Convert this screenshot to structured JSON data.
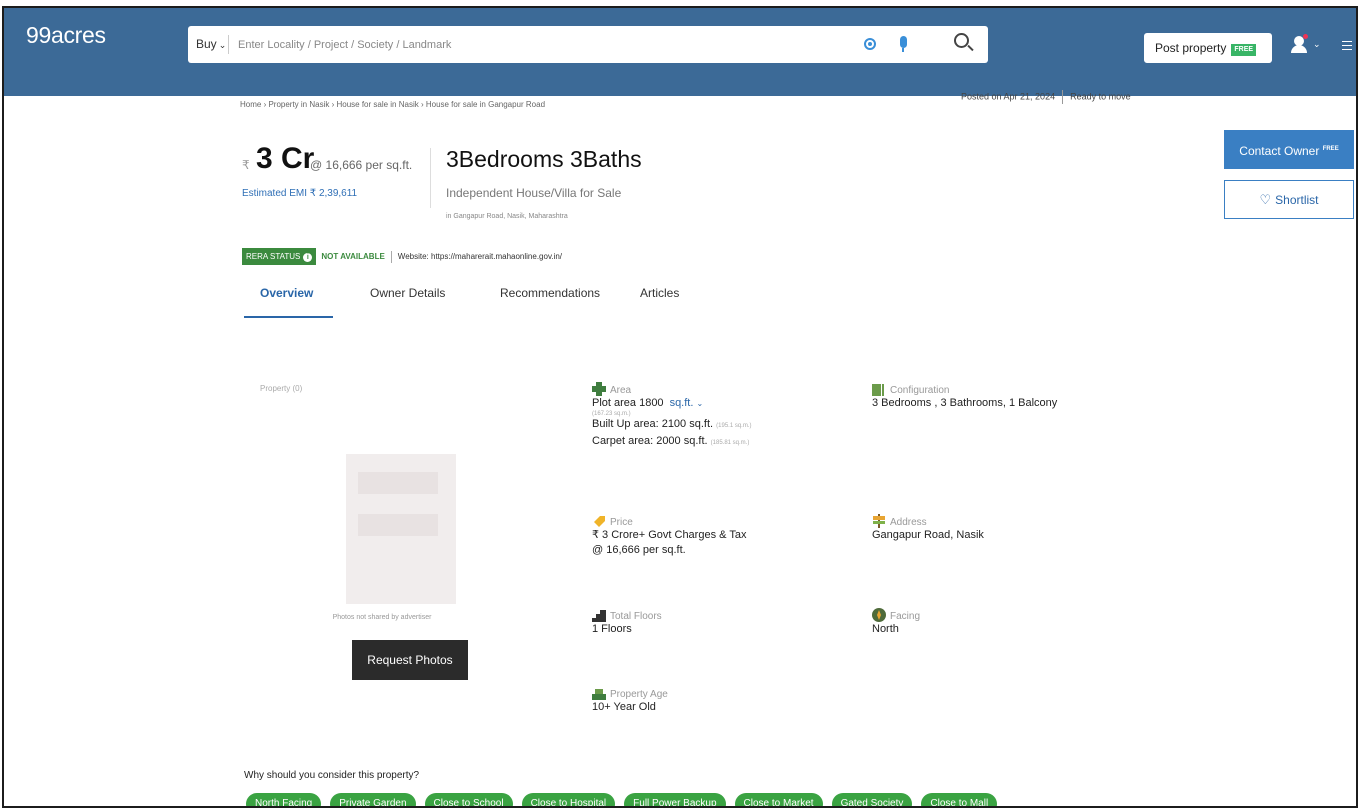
{
  "header": {
    "logo": "99acres",
    "search": {
      "category": "Buy",
      "placeholder": "Enter Locality / Project / Society / Landmark"
    },
    "post_property_label": "Post property",
    "post_property_tag": "FREE"
  },
  "breadcrumb": "Home › Property in Nasik › House for sale in Nasik › House for sale in Gangapur Road",
  "posted": {
    "date": "Posted on Apr 21, 2024",
    "status": "Ready to move"
  },
  "summary": {
    "price": "3 Cr",
    "per_sqft": "@ 16,666 per sq.ft.",
    "emi": "Estimated EMI ₹ 2,39,611",
    "bhk_title": "3Bedrooms 3Baths",
    "property_type": "Independent House/Villa for Sale",
    "locality": "in Gangapur Road, Nasik, Maharashtra"
  },
  "rera": {
    "badge": "RERA STATUS",
    "status": "NOT AVAILABLE",
    "website": "Website: https://maharerait.mahaonline.gov.in/"
  },
  "tabs": [
    "Overview",
    "Owner Details",
    "Recommendations",
    "Articles"
  ],
  "actions": {
    "contact_owner": "Contact Owner",
    "contact_tag": "FREE",
    "shortlist": "Shortlist"
  },
  "photos": {
    "label": "Property (0)",
    "note": "Photos not shared by advertiser",
    "request_button": "Request Photos"
  },
  "specs": {
    "area": {
      "heading": "Area",
      "plot": "Plot area 1800",
      "unit": "sq.ft.",
      "plot_sqm": "(167.23 sq.m.)",
      "built_up": "Built Up area: 2100 sq.ft.",
      "built_up_sqm": "(195.1 sq.m.)",
      "carpet": "Carpet area: 2000 sq.ft.",
      "carpet_sqm": "(185.81 sq.m.)"
    },
    "configuration": {
      "heading": "Configuration",
      "value": "3 Bedrooms , 3 Bathrooms, 1 Balcony"
    },
    "price": {
      "heading": "Price",
      "value": "₹ 3 Crore+ Govt Charges & Tax",
      "per_sqft": "@ 16,666 per sq.ft."
    },
    "address": {
      "heading": "Address",
      "value": "Gangapur Road, Nasik"
    },
    "total_floors": {
      "heading": "Total Floors",
      "value": "1 Floors"
    },
    "facing": {
      "heading": "Facing",
      "value": "North"
    },
    "property_age": {
      "heading": "Property Age",
      "value": "10+ Year Old"
    }
  },
  "why": {
    "title": "Why should you consider this property?",
    "chips": [
      "North Facing",
      "Private Garden",
      "Close to School",
      "Close to Hospital",
      "Full Power Backup",
      "Close to Market",
      "Gated Society",
      "Close to Mall"
    ]
  },
  "colors": {
    "header": "#3c6a97",
    "accent": "#2a66a8",
    "chip": "#3aa342",
    "rera": "#3b8a3e"
  }
}
